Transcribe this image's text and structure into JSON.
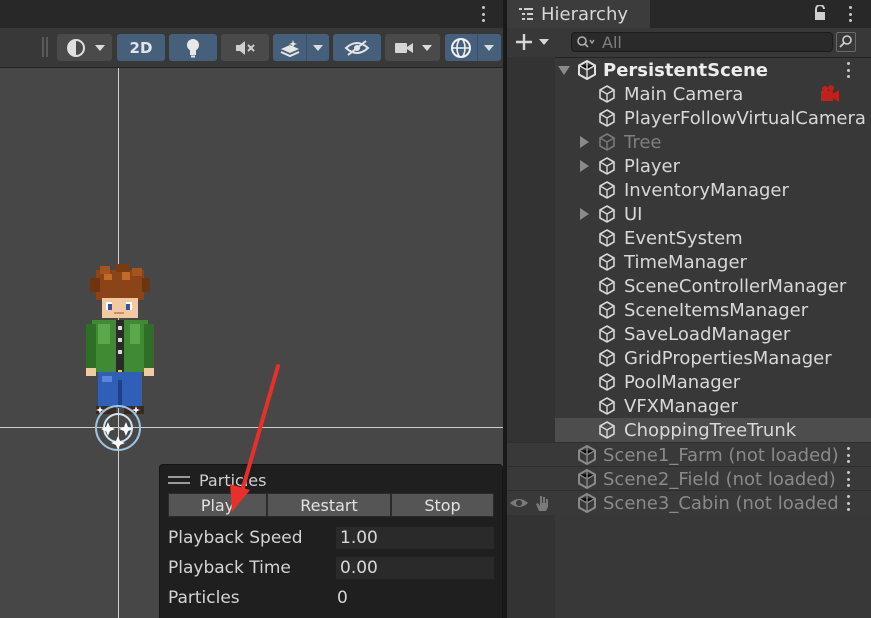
{
  "scene_toolbar": {
    "mode_2d_label": "2D"
  },
  "particles_panel": {
    "title": "Particles",
    "play_label": "Play",
    "restart_label": "Restart",
    "stop_label": "Stop",
    "playback_speed_label": "Playback Speed",
    "playback_speed_value": "1.00",
    "playback_time_label": "Playback Time",
    "playback_time_value": "0.00",
    "particles_label": "Particles",
    "particles_value": "0"
  },
  "hierarchy": {
    "tab_title": "Hierarchy",
    "search_placeholder": "All",
    "root_scene": "PersistentScene",
    "items": [
      {
        "label": "Main Camera"
      },
      {
        "label": "PlayerFollowVirtualCamera"
      },
      {
        "label": "Tree"
      },
      {
        "label": "Player"
      },
      {
        "label": "InventoryManager"
      },
      {
        "label": "UI"
      },
      {
        "label": "EventSystem"
      },
      {
        "label": "TimeManager"
      },
      {
        "label": "SceneControllerManager"
      },
      {
        "label": "SceneItemsManager"
      },
      {
        "label": "SaveLoadManager"
      },
      {
        "label": "GridPropertiesManager"
      },
      {
        "label": "PoolManager"
      },
      {
        "label": "VFXManager"
      },
      {
        "label": "ChoppingTreeTrunk"
      }
    ],
    "unloaded_scenes": [
      {
        "label": "Scene1_Farm (not loaded)"
      },
      {
        "label": "Scene2_Field (not loaded)"
      },
      {
        "label": "Scene3_Cabin (not loaded"
      }
    ]
  },
  "colors": {
    "selection": "#4d4d4d",
    "toggle_on": "#46607c",
    "annotation_arrow": "#e8302a"
  }
}
